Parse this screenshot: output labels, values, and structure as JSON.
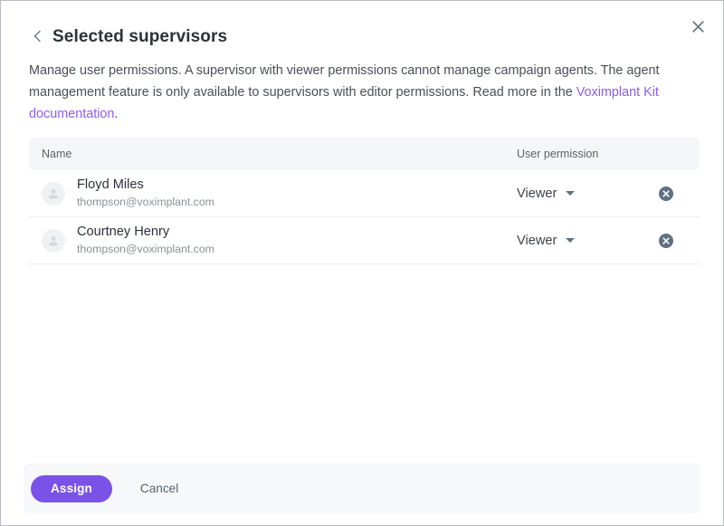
{
  "dialog": {
    "title": "Selected supervisors",
    "back_icon": "chevron-left-icon",
    "close_icon": "close-icon",
    "description": {
      "part1": "Manage user permissions. A supervisor with viewer permissions cannot manage campaign agents. The agent management feature is only available to supervisors with editor permissions. Read more in the ",
      "link_text": "Voximplant Kit documentation",
      "part2": "."
    }
  },
  "table": {
    "columns": {
      "name": "Name",
      "permission": "User permission"
    },
    "rows": [
      {
        "name": "Floyd Miles",
        "email": "thompson@voximplant.com",
        "permission": "Viewer",
        "avatar_icon": "person-icon",
        "remove_icon": "remove-circle-icon"
      },
      {
        "name": "Courtney Henry",
        "email": "thompson@voximplant.com",
        "permission": "Viewer",
        "avatar_icon": "person-icon",
        "remove_icon": "remove-circle-icon"
      }
    ]
  },
  "footer": {
    "assign_label": "Assign",
    "cancel_label": "Cancel"
  },
  "colors": {
    "accent": "#7b52e8",
    "link": "#8b5cf6",
    "title_text": "#2c3238",
    "body_text": "#4a5056",
    "muted_text": "#8a9199",
    "header_bg": "#f5f6f8",
    "footer_bg": "#f7f8fa",
    "icon_slate": "#5f7183"
  }
}
